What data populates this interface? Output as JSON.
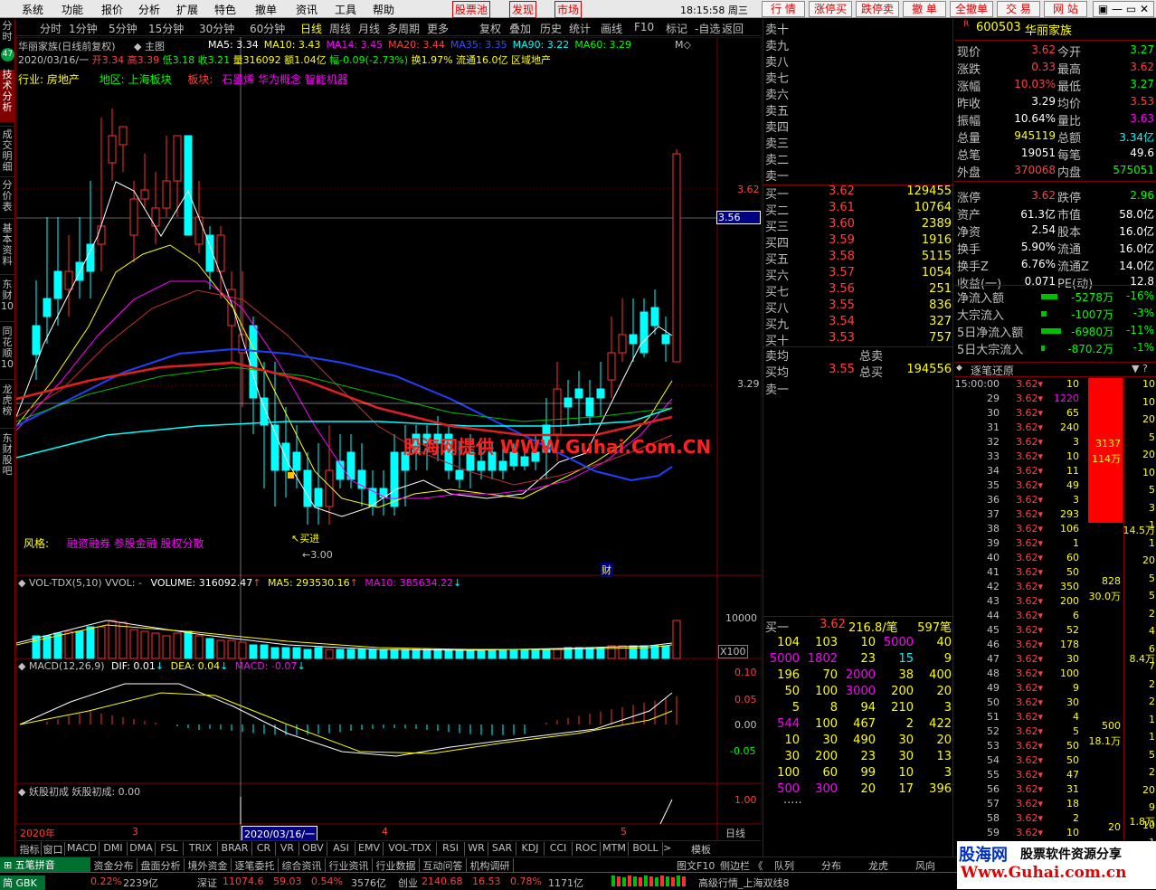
{
  "menu": [
    "系统",
    "功能",
    "报价",
    "分析",
    "扩展",
    "特色",
    "撤单",
    "资讯",
    "工具",
    "帮助"
  ],
  "menu_red": [
    "股票池",
    "发现",
    "市场"
  ],
  "clock": "18:15:58 周三",
  "top_buttons": [
    "行 情",
    "涨停买",
    "跌停卖",
    "撤 单",
    "全撤单",
    "交 易",
    "网 站"
  ],
  "left_tabs": [
    "分时",
    "技术分析",
    "成交明细",
    "分价表",
    "基本资料",
    "东财10",
    "同花顺10",
    "龙虎榜",
    "东财股吧"
  ],
  "left_badge": "47",
  "periods": [
    "分时",
    "1分钟",
    "5分钟",
    "15分钟",
    "30分钟",
    "60分钟",
    "日线",
    "周线",
    "月线",
    "多周期",
    "更多"
  ],
  "period_cur": "日线",
  "right_tools": [
    "复权",
    "叠加",
    "历史",
    "统计",
    "画线",
    "F10",
    "标记",
    "-自选",
    "返回"
  ],
  "chart_header": {
    "name": "华丽家族(日线前复权)",
    "main": "主图",
    "ma": [
      {
        "t": "MA5: 3.34",
        "c": "#ffffff"
      },
      {
        "t": "MA10: 3.43",
        "c": "#ffff00"
      },
      {
        "t": "MA14: 3.45",
        "c": "#ff00ff"
      },
      {
        "t": "MA20: 3.44",
        "c": "#ff4040"
      },
      {
        "t": "MA35: 3.35",
        "c": "#3050ff"
      },
      {
        "t": "MA90: 3.22",
        "c": "#00ffff"
      },
      {
        "t": "MA60: 3.29",
        "c": "#00ff00"
      }
    ],
    "line2_date": "2020/03/16/一",
    "line2_open": "开3.34",
    "line2_high": "高3.39",
    "line2_low": "低3.18",
    "line2_close": "收3.21",
    "line2_vol": "量316092",
    "line2_amt": "额1.04亿",
    "line2_chg": "幅-0.09(-2.73%)",
    "line2_turn": "换1.97%",
    "line2_float": "流通16.0亿",
    "line2_region": "区域地产"
  },
  "chart_info": {
    "industry_label": "行业:",
    "industry": "房地产",
    "region": "地区: 上海板块",
    "block_label": "板块:",
    "blocks": "石墨烯 华为概念 智能机器",
    "style_label": "风格:",
    "styles": "融资融券 参股金融 股权分散",
    "low_label": "←3.00",
    "buy_label": "↖买进",
    "cai": "财"
  },
  "price_axis": {
    "top": "3.62",
    "cur": "3.56",
    "mid": "3.29"
  },
  "watermark": "股海网提供 WWW.Guhai.Com.CN",
  "vol_header": {
    "name": "VOL-TDX(5,10)",
    "vvol": "VVOL: -",
    "volume": "VOLUME: 316092.47",
    "ma5": "MA5: 293530.16",
    "ma10": "MA10: 385634.22"
  },
  "vol_axis": {
    "top": "10000",
    "unit": "X100"
  },
  "macd_header": {
    "name": "MACD(12,26,9)",
    "dif": "DIF: 0.01",
    "dea": "DEA: 0.04",
    "macd": "MACD: -0.07"
  },
  "macd_axis": [
    "0.10",
    "0.05",
    "0.00",
    "-0.05"
  ],
  "yao_header": {
    "name": "妖股初成",
    "val": "妖股初成: 0.00"
  },
  "yao_axis": "1.00",
  "xaxis": {
    "y2020": "2020年",
    "m3": "3",
    "cur": "2020/03/16/一",
    "m4": "4",
    "m5": "5",
    "period": "日线"
  },
  "indicators": [
    "指标",
    "窗口",
    "MACD",
    "DMI",
    "DMA",
    "FSL",
    "TRIX",
    "BRAR",
    "CR",
    "VR",
    "OBV",
    "ASI",
    "EMV",
    "VOL-TDX",
    "RSI",
    "WR",
    "SAR",
    "KDJ",
    "CCI",
    "ROC",
    "MTM",
    "BOLL"
  ],
  "bot1_right": "模板",
  "bot2": {
    "input": "五笔拼音",
    "tabs": [
      "资金分布",
      "盘面分析",
      "境外资金",
      "逐笔委托",
      "综合资讯",
      "行业资讯",
      "行业数据",
      "互动问答",
      "机构调研"
    ],
    "f10": "图文F10",
    "side": "侧边栏 《",
    "right_tabs": [
      "队列",
      "分布",
      "龙虎",
      "风向"
    ]
  },
  "bot3": {
    "ime": "简 GBK",
    "sz_pct": "0.22%",
    "sz_amt": "2239亿",
    "sz": "深证",
    "sz_val": "11074.6",
    "sz_chg": "59.03",
    "sz_pct2": "0.54%",
    "sz_amt2": "3576亿",
    "cy": "创业",
    "cy_val": "2140.68",
    "cy_chg": "16.53",
    "cy_pct": "0.78%",
    "cy_amt": "1171亿",
    "ticker": "高级行情_上海双线8"
  },
  "logo": {
    "main": "股海网",
    "sub": "股票软件资源分享",
    "url": "Www.Guhai.com.cn"
  },
  "book": {
    "sells": [
      "卖十",
      "卖九",
      "卖八",
      "卖七",
      "卖六",
      "卖五",
      "卖四",
      "卖三",
      "卖二",
      "卖一"
    ],
    "buys": [
      {
        "l": "买一",
        "p": "3.62",
        "v": "129455"
      },
      {
        "l": "买二",
        "p": "3.61",
        "v": "10764"
      },
      {
        "l": "买三",
        "p": "3.60",
        "v": "2389"
      },
      {
        "l": "买四",
        "p": "3.59",
        "v": "1916"
      },
      {
        "l": "买五",
        "p": "3.58",
        "v": "5115"
      },
      {
        "l": "买六",
        "p": "3.57",
        "v": "1054"
      },
      {
        "l": "买七",
        "p": "3.56",
        "v": "251"
      },
      {
        "l": "买八",
        "p": "3.55",
        "v": "836"
      },
      {
        "l": "买九",
        "p": "3.54",
        "v": "327"
      },
      {
        "l": "买十",
        "p": "3.53",
        "v": "757"
      }
    ],
    "avg_sell": "卖均",
    "total_sell": "总卖",
    "avg_buy": "买均",
    "avg_buy_p": "3.55",
    "total_buy": "总买",
    "total_buy_v": "194556",
    "sell1": "卖一",
    "queue_label": "买一",
    "queue_price": "3.62",
    "queue_avg": "216.8/笔",
    "queue_cnt": "597笔",
    "queue": [
      [
        "104",
        "103",
        "10",
        "5000",
        "40"
      ],
      [
        "5000",
        "1802",
        "23",
        "15",
        "9"
      ],
      [
        "196",
        "70",
        "2000",
        "38",
        "400"
      ],
      [
        "50",
        "100",
        "3000",
        "200",
        "20"
      ],
      [
        "5",
        "8",
        "94",
        "210",
        "3"
      ],
      [
        "544",
        "100",
        "467",
        "2",
        "422"
      ],
      [
        "10",
        "30",
        "490",
        "30",
        "20"
      ],
      [
        "30",
        "200",
        "23",
        "30",
        "13"
      ],
      [
        "100",
        "60",
        "99",
        "10",
        "3"
      ],
      [
        "500",
        "300",
        "20",
        "17",
        "396"
      ]
    ],
    "queue_more": "....."
  },
  "quote": {
    "code": "600503",
    "name": "华丽家族",
    "r": "R",
    "rows": [
      [
        "现价",
        "3.62",
        "今开",
        "3.27"
      ],
      [
        "涨跌",
        "0.33",
        "最高",
        "3.62"
      ],
      [
        "涨幅",
        "10.03%",
        "最低",
        "3.27"
      ],
      [
        "昨收",
        "3.29",
        "均价",
        "3.53"
      ],
      [
        "振幅",
        "10.64%",
        "量比",
        "3.63"
      ],
      [
        "总量",
        "945119",
        "总额",
        "3.34亿"
      ],
      [
        "总笔",
        "19051",
        "每笔",
        "49.6"
      ],
      [
        "外盘",
        "370068",
        "内盘",
        "575051"
      ],
      [
        "涨停",
        "3.62",
        "跌停",
        "2.96"
      ],
      [
        "资产",
        "61.3亿",
        "市值",
        "58.0亿"
      ],
      [
        "净资",
        "2.54",
        "股本",
        "16.0亿"
      ],
      [
        "换手",
        "5.90%",
        "流通",
        "16.0亿"
      ],
      [
        "换手Z",
        "6.76%",
        "流通Z",
        "14.0亿"
      ],
      [
        "收益(一)",
        "0.071",
        "PE(动)",
        "12.8"
      ]
    ],
    "flows": [
      [
        "净流入额",
        "-5278万",
        "-16%"
      ],
      [
        "大宗流入",
        "-1007万",
        "-3%"
      ],
      [
        "5日净流入额",
        "-6980万",
        "-11%"
      ],
      [
        "5日大宗流入",
        "-870.2万",
        "-1%"
      ]
    ]
  },
  "ticks": {
    "title": "逐笔还原",
    "rows": [
      [
        "15:00:00",
        "3.62",
        "10"
      ],
      [
        "29",
        "3.62",
        "1220"
      ],
      [
        "30",
        "3.62",
        "65"
      ],
      [
        "31",
        "3.62",
        "240"
      ],
      [
        "32",
        "3.62",
        "3"
      ],
      [
        "33",
        "3.62",
        "10"
      ],
      [
        "34",
        "3.62",
        "11"
      ],
      [
        "35",
        "3.62",
        "49"
      ],
      [
        "36",
        "3.62",
        "3"
      ],
      [
        "37",
        "3.62",
        "293"
      ],
      [
        "38",
        "3.62",
        "106"
      ],
      [
        "39",
        "3.62",
        "1"
      ],
      [
        "40",
        "3.62",
        "60"
      ],
      [
        "41",
        "3.62",
        "50"
      ],
      [
        "42",
        "3.62",
        "350"
      ],
      [
        "43",
        "3.62",
        "200"
      ],
      [
        "44",
        "3.62",
        "6"
      ],
      [
        "45",
        "3.62",
        "52"
      ],
      [
        "46",
        "3.62",
        "178"
      ],
      [
        "47",
        "3.62",
        "30"
      ],
      [
        "48",
        "3.62",
        "100"
      ],
      [
        "49",
        "3.62",
        "9"
      ],
      [
        "50",
        "3.62",
        "30"
      ],
      [
        "51",
        "3.62",
        "4"
      ],
      [
        "52",
        "3.62",
        "5"
      ],
      [
        "53",
        "3.62",
        "50"
      ],
      [
        "54",
        "3.62",
        "50"
      ],
      [
        "55",
        "3.62",
        "47"
      ],
      [
        "56",
        "3.62",
        "31"
      ],
      [
        "57",
        "3.62",
        "18"
      ],
      [
        "58",
        "3.62",
        "2"
      ],
      [
        "59",
        "3.62",
        "10"
      ]
    ],
    "big1": "3137",
    "big1b": "114万",
    "mid1": "828",
    "mid1b": "30.0万",
    "mid2": "500",
    "mid2b": "18.1万",
    "right": [
      "10",
      "10",
      "20",
      "5",
      "20",
      "10",
      "5",
      "3",
      "1",
      "1",
      "20",
      "5",
      "5",
      "2",
      "4",
      "6",
      "7",
      "2",
      "2",
      "1",
      "1",
      "5",
      "2",
      "20",
      "9",
      "10",
      "1"
    ],
    "rlab": [
      "14.5万",
      "12",
      "8.4万",
      "1.8万"
    ],
    "r20": "20"
  },
  "chart_data": {
    "type": "candlestick",
    "title": "华丽家族(日线前复权)",
    "ylim": [
      3.0,
      3.62
    ],
    "xlabels": [
      "2020年",
      "3",
      "4",
      "5"
    ]
  }
}
